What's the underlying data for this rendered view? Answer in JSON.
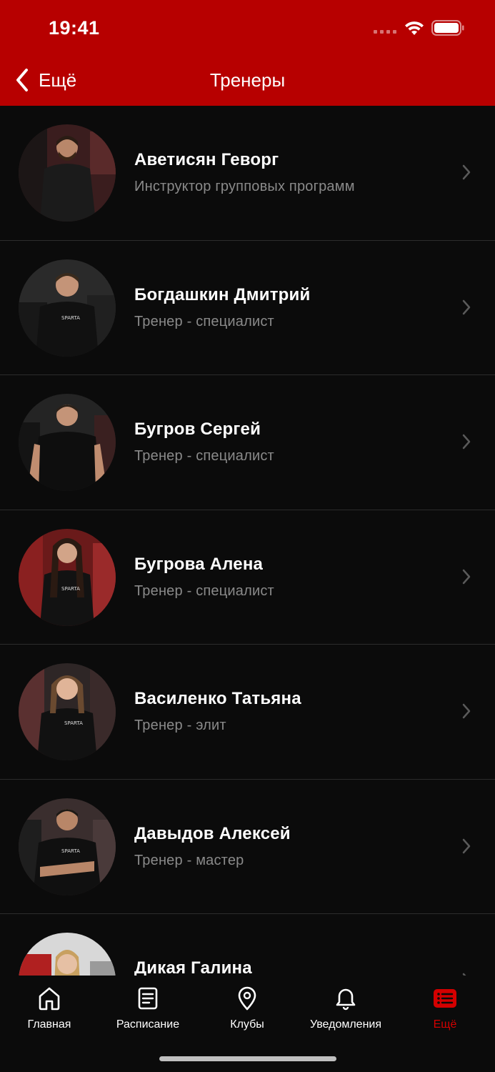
{
  "status_bar": {
    "time": "19:41"
  },
  "nav": {
    "back_label": "Ещё",
    "title": "Тренеры"
  },
  "colors": {
    "brand": "#b70000",
    "accent": "#d40000",
    "background": "#0b0b0b",
    "secondary_text": "#8a8a8a"
  },
  "trainers": [
    {
      "name": "Аветисян Геворг",
      "role": "Инструктор групповых программ"
    },
    {
      "name": "Богдашкин Дмитрий",
      "role": "Тренер - специалист"
    },
    {
      "name": "Бугров Сергей",
      "role": "Тренер - специалист"
    },
    {
      "name": "Бугрова Алена",
      "role": "Тренер - специалист"
    },
    {
      "name": "Василенко  Татьяна",
      "role": "Тренер - элит"
    },
    {
      "name": "Давыдов Алексей",
      "role": "Тренер - мастер"
    },
    {
      "name": "Дикая Галина",
      "role": ""
    }
  ],
  "tabbar": {
    "items": [
      {
        "label": "Главная",
        "icon": "home-icon"
      },
      {
        "label": "Расписание",
        "icon": "schedule-icon"
      },
      {
        "label": "Клубы",
        "icon": "location-pin-icon"
      },
      {
        "label": "Уведомления",
        "icon": "bell-icon"
      },
      {
        "label": "Ещё",
        "icon": "more-list-icon",
        "active": true
      }
    ]
  }
}
